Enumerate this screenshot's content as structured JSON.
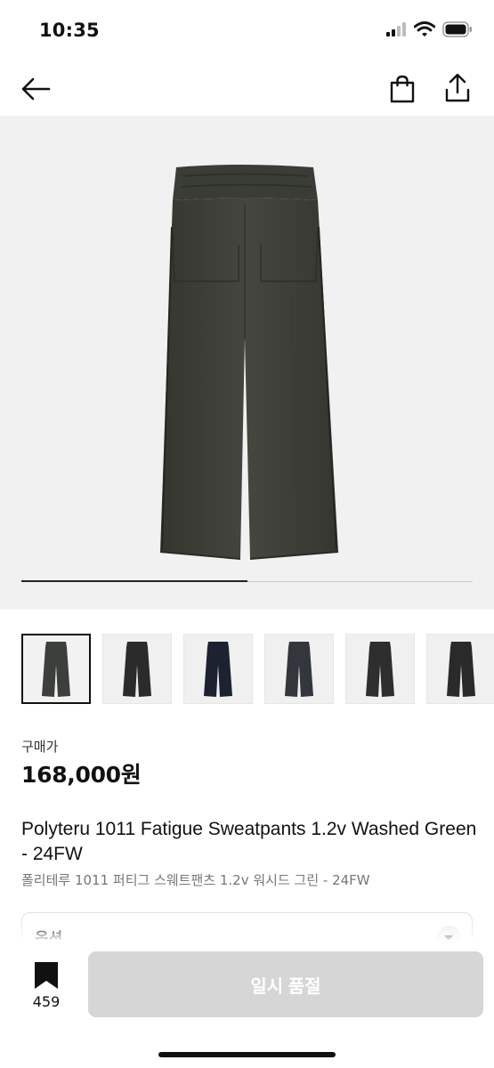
{
  "status_bar": {
    "time": "10:35",
    "icons": [
      "signal-icon",
      "wifi-icon",
      "battery-icon"
    ]
  },
  "nav": {
    "icons": [
      "back-arrow-icon",
      "shopping-bag-icon",
      "share-icon"
    ]
  },
  "gallery": {
    "progress_fraction": 0.5,
    "thumbnails": [
      {
        "color": "#3d3f3b",
        "selected": true
      },
      {
        "color": "#2b2b2b",
        "selected": false
      },
      {
        "color": "#1c2230",
        "selected": false
      },
      {
        "color": "#33363c",
        "selected": false
      },
      {
        "color": "#2e2e2e",
        "selected": false
      },
      {
        "color": "#2a2a2a",
        "selected": false
      }
    ]
  },
  "product": {
    "price_label": "구매가",
    "price": "168,000원",
    "name_en": "Polyteru 1011 Fatigue Sweatpants 1.2v Washed Green - 24FW",
    "name_ko": "폴리테루 1011 퍼티그 스웨트팬츠 1.2v 워시드 그린 - 24FW"
  },
  "options": {
    "label": "옵션"
  },
  "bottom": {
    "bookmark_count": "459",
    "soldout_label": "일시 품절"
  },
  "colors": {
    "product_main": "#3d3f3b",
    "button_disabled": "#d6d6d6",
    "hero_bg": "#f1f1f1"
  }
}
